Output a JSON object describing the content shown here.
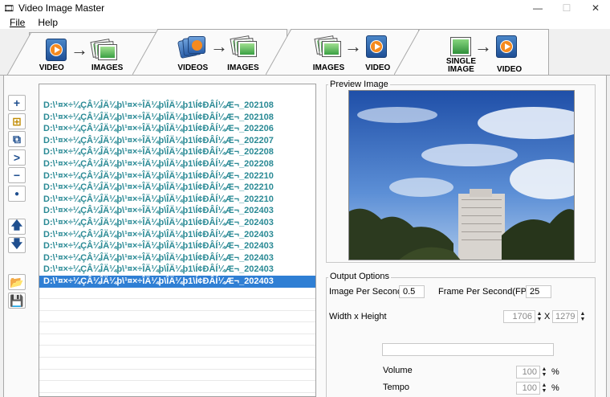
{
  "window": {
    "title": "Video Image Master"
  },
  "menu": {
    "file": "File",
    "help": "Help"
  },
  "tabs": [
    {
      "left": "VIDEO",
      "right": "IMAGES"
    },
    {
      "left": "VIDEOS",
      "right": "IMAGES"
    },
    {
      "left": "IMAGES",
      "right": "VIDEO"
    },
    {
      "left": "SINGLE\nIMAGE",
      "right": "VIDEO"
    }
  ],
  "files": [
    "D:\\¹¤×÷¼ÇÂ¼ÎÄ¼þ\\¹¤×÷ÎÄ¼þ\\ÎÄ¼þ1\\Í¢ÐÂÍ¼Æ¬_202108",
    "D:\\¹¤×÷¼ÇÂ¼ÎÄ¼þ\\¹¤×÷ÎÄ¼þ\\ÎÄ¼þ1\\Í¢ÐÂÍ¼Æ¬_202108",
    "D:\\¹¤×÷¼ÇÂ¼ÎÄ¼þ\\¹¤×÷ÎÄ¼þ\\ÎÄ¼þ1\\Í¢ÐÂÍ¼Æ¬_202206",
    "D:\\¹¤×÷¼ÇÂ¼ÎÄ¼þ\\¹¤×÷ÎÄ¼þ\\ÎÄ¼þ1\\Í¢ÐÂÍ¼Æ¬_202207",
    "D:\\¹¤×÷¼ÇÂ¼ÎÄ¼þ\\¹¤×÷ÎÄ¼þ\\ÎÄ¼þ1\\Í¢ÐÂÍ¼Æ¬_202208",
    "D:\\¹¤×÷¼ÇÂ¼ÎÄ¼þ\\¹¤×÷ÎÄ¼þ\\ÎÄ¼þ1\\Í¢ÐÂÍ¼Æ¬_202208",
    "D:\\¹¤×÷¼ÇÂ¼ÎÄ¼þ\\¹¤×÷ÎÄ¼þ\\ÎÄ¼þ1\\Í¢ÐÂÍ¼Æ¬_202210",
    "D:\\¹¤×÷¼ÇÂ¼ÎÄ¼þ\\¹¤×÷ÎÄ¼þ\\ÎÄ¼þ1\\Í¢ÐÂÍ¼Æ¬_202210",
    "D:\\¹¤×÷¼ÇÂ¼ÎÄ¼þ\\¹¤×÷ÎÄ¼þ\\ÎÄ¼þ1\\Í¢ÐÂÍ¼Æ¬_202210",
    "D:\\¹¤×÷¼ÇÂ¼ÎÄ¼þ\\¹¤×÷ÎÄ¼þ\\ÎÄ¼þ1\\Í¢ÐÂÍ¼Æ¬_202403",
    "D:\\¹¤×÷¼ÇÂ¼ÎÄ¼þ\\¹¤×÷ÎÄ¼þ\\ÎÄ¼þ1\\Í¢ÐÂÍ¼Æ¬_202403",
    "D:\\¹¤×÷¼ÇÂ¼ÎÄ¼þ\\¹¤×÷ÎÄ¼þ\\ÎÄ¼þ1\\Í¢ÐÂÍ¼Æ¬_202403",
    "D:\\¹¤×÷¼ÇÂ¼ÎÄ¼þ\\¹¤×÷ÎÄ¼þ\\ÎÄ¼þ1\\Í¢ÐÂÍ¼Æ¬_202403",
    "D:\\¹¤×÷¼ÇÂ¼ÎÄ¼þ\\¹¤×÷ÎÄ¼þ\\ÎÄ¼þ1\\Í¢ÐÂÍ¼Æ¬_202403",
    "D:\\¹¤×÷¼ÇÂ¼ÎÄ¼þ\\¹¤×÷ÎÄ¼þ\\ÎÄ¼þ1\\Í¢ÐÂÍ¼Æ¬_202403",
    "D:\\¹¤×÷¼ÇÂ¼ÎÄ¼þ\\¹¤×÷ÎÄ¼þ\\ÎÄ¼þ1\\Í¢ÐÂÍ¼Æ¬_202403"
  ],
  "selected_file_index": 15,
  "preview": {
    "label": "Preview Image"
  },
  "output": {
    "label": "Output Options",
    "image_per_second_label": "Image Per Second",
    "image_per_second_value": "0.5",
    "fps_label": "Frame Per Second(FPS)",
    "fps_value": "25",
    "wh_label": "Width x Height",
    "width_value": "1706",
    "x_label": "X",
    "height_value": "1279",
    "volume_label": "Volume",
    "volume_value": "100",
    "tempo_label": "Tempo",
    "tempo_value": "100",
    "percent": "%"
  },
  "colors": {
    "accent": "#2f7fd4",
    "file_text": "#2a8a95"
  }
}
